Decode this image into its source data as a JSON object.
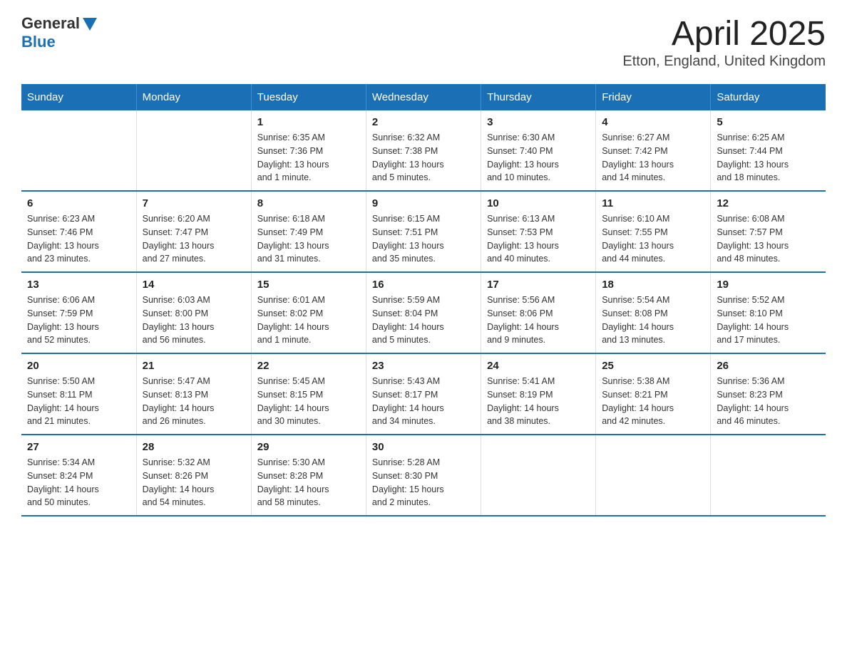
{
  "header": {
    "logo_general": "General",
    "logo_blue": "Blue",
    "title": "April 2025",
    "subtitle": "Etton, England, United Kingdom"
  },
  "days_of_week": [
    "Sunday",
    "Monday",
    "Tuesday",
    "Wednesday",
    "Thursday",
    "Friday",
    "Saturday"
  ],
  "weeks": [
    [
      {
        "day": "",
        "info": ""
      },
      {
        "day": "",
        "info": ""
      },
      {
        "day": "1",
        "info": "Sunrise: 6:35 AM\nSunset: 7:36 PM\nDaylight: 13 hours\nand 1 minute."
      },
      {
        "day": "2",
        "info": "Sunrise: 6:32 AM\nSunset: 7:38 PM\nDaylight: 13 hours\nand 5 minutes."
      },
      {
        "day": "3",
        "info": "Sunrise: 6:30 AM\nSunset: 7:40 PM\nDaylight: 13 hours\nand 10 minutes."
      },
      {
        "day": "4",
        "info": "Sunrise: 6:27 AM\nSunset: 7:42 PM\nDaylight: 13 hours\nand 14 minutes."
      },
      {
        "day": "5",
        "info": "Sunrise: 6:25 AM\nSunset: 7:44 PM\nDaylight: 13 hours\nand 18 minutes."
      }
    ],
    [
      {
        "day": "6",
        "info": "Sunrise: 6:23 AM\nSunset: 7:46 PM\nDaylight: 13 hours\nand 23 minutes."
      },
      {
        "day": "7",
        "info": "Sunrise: 6:20 AM\nSunset: 7:47 PM\nDaylight: 13 hours\nand 27 minutes."
      },
      {
        "day": "8",
        "info": "Sunrise: 6:18 AM\nSunset: 7:49 PM\nDaylight: 13 hours\nand 31 minutes."
      },
      {
        "day": "9",
        "info": "Sunrise: 6:15 AM\nSunset: 7:51 PM\nDaylight: 13 hours\nand 35 minutes."
      },
      {
        "day": "10",
        "info": "Sunrise: 6:13 AM\nSunset: 7:53 PM\nDaylight: 13 hours\nand 40 minutes."
      },
      {
        "day": "11",
        "info": "Sunrise: 6:10 AM\nSunset: 7:55 PM\nDaylight: 13 hours\nand 44 minutes."
      },
      {
        "day": "12",
        "info": "Sunrise: 6:08 AM\nSunset: 7:57 PM\nDaylight: 13 hours\nand 48 minutes."
      }
    ],
    [
      {
        "day": "13",
        "info": "Sunrise: 6:06 AM\nSunset: 7:59 PM\nDaylight: 13 hours\nand 52 minutes."
      },
      {
        "day": "14",
        "info": "Sunrise: 6:03 AM\nSunset: 8:00 PM\nDaylight: 13 hours\nand 56 minutes."
      },
      {
        "day": "15",
        "info": "Sunrise: 6:01 AM\nSunset: 8:02 PM\nDaylight: 14 hours\nand 1 minute."
      },
      {
        "day": "16",
        "info": "Sunrise: 5:59 AM\nSunset: 8:04 PM\nDaylight: 14 hours\nand 5 minutes."
      },
      {
        "day": "17",
        "info": "Sunrise: 5:56 AM\nSunset: 8:06 PM\nDaylight: 14 hours\nand 9 minutes."
      },
      {
        "day": "18",
        "info": "Sunrise: 5:54 AM\nSunset: 8:08 PM\nDaylight: 14 hours\nand 13 minutes."
      },
      {
        "day": "19",
        "info": "Sunrise: 5:52 AM\nSunset: 8:10 PM\nDaylight: 14 hours\nand 17 minutes."
      }
    ],
    [
      {
        "day": "20",
        "info": "Sunrise: 5:50 AM\nSunset: 8:11 PM\nDaylight: 14 hours\nand 21 minutes."
      },
      {
        "day": "21",
        "info": "Sunrise: 5:47 AM\nSunset: 8:13 PM\nDaylight: 14 hours\nand 26 minutes."
      },
      {
        "day": "22",
        "info": "Sunrise: 5:45 AM\nSunset: 8:15 PM\nDaylight: 14 hours\nand 30 minutes."
      },
      {
        "day": "23",
        "info": "Sunrise: 5:43 AM\nSunset: 8:17 PM\nDaylight: 14 hours\nand 34 minutes."
      },
      {
        "day": "24",
        "info": "Sunrise: 5:41 AM\nSunset: 8:19 PM\nDaylight: 14 hours\nand 38 minutes."
      },
      {
        "day": "25",
        "info": "Sunrise: 5:38 AM\nSunset: 8:21 PM\nDaylight: 14 hours\nand 42 minutes."
      },
      {
        "day": "26",
        "info": "Sunrise: 5:36 AM\nSunset: 8:23 PM\nDaylight: 14 hours\nand 46 minutes."
      }
    ],
    [
      {
        "day": "27",
        "info": "Sunrise: 5:34 AM\nSunset: 8:24 PM\nDaylight: 14 hours\nand 50 minutes."
      },
      {
        "day": "28",
        "info": "Sunrise: 5:32 AM\nSunset: 8:26 PM\nDaylight: 14 hours\nand 54 minutes."
      },
      {
        "day": "29",
        "info": "Sunrise: 5:30 AM\nSunset: 8:28 PM\nDaylight: 14 hours\nand 58 minutes."
      },
      {
        "day": "30",
        "info": "Sunrise: 5:28 AM\nSunset: 8:30 PM\nDaylight: 15 hours\nand 2 minutes."
      },
      {
        "day": "",
        "info": ""
      },
      {
        "day": "",
        "info": ""
      },
      {
        "day": "",
        "info": ""
      }
    ]
  ]
}
